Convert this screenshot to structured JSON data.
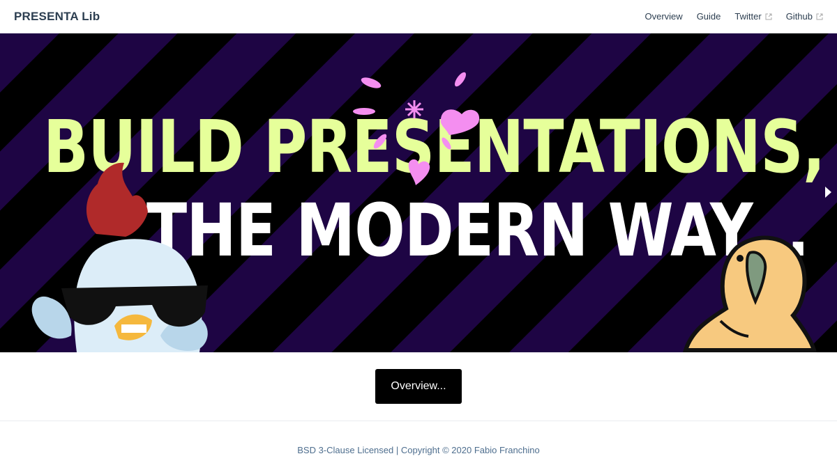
{
  "navbar": {
    "brand": "PRESENTA Lib",
    "links": [
      {
        "label": "Overview",
        "external": false
      },
      {
        "label": "Guide",
        "external": false
      },
      {
        "label": "Twitter",
        "external": true
      },
      {
        "label": "Github",
        "external": true
      }
    ]
  },
  "hero": {
    "line1": "BUILD PRESENTATIONS,",
    "line2": "THE MODERN WAY...",
    "colors": {
      "background": "#000000",
      "stripe": "#1e0544",
      "line1": "#e6ff9a",
      "line2": "#ffffff",
      "confetti": "#f48ef0"
    },
    "icons": [
      "chicken-sunglasses-sticker",
      "parrot-sticker",
      "next-slide-arrow-icon"
    ]
  },
  "cta": {
    "label": "Overview..."
  },
  "footer": {
    "text": "BSD 3-Clause Licensed | Copyright © 2020 Fabio Franchino"
  }
}
